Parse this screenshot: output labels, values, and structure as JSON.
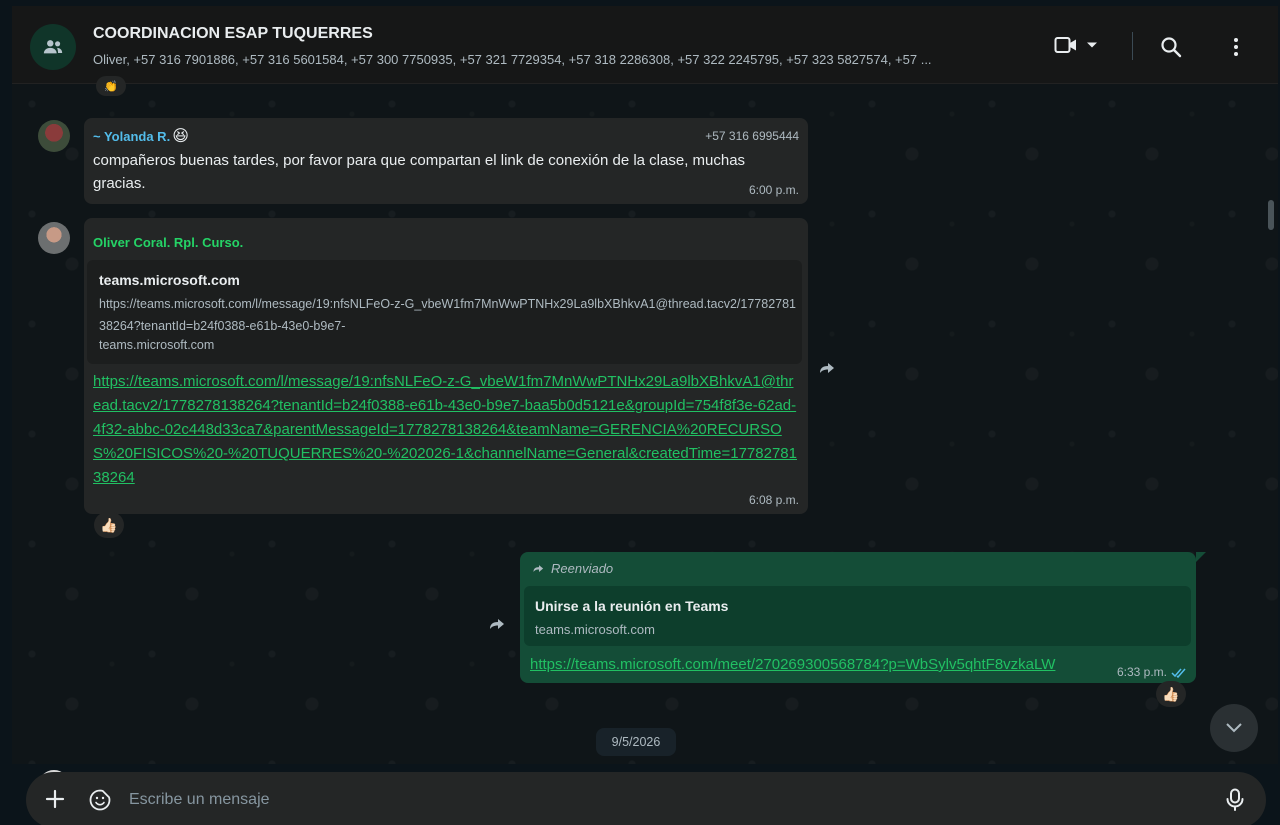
{
  "header": {
    "title": "COORDINACION ESAP TUQUERRES",
    "members": "Oliver, +57 316 7901886, +57 316 5601584, +57 300 7750935, +57 321 7729354, +57 318 2286308, +57 322 2245795, +57 323 5827574, +57 ..."
  },
  "messages": {
    "m1": {
      "sender": "~ Yolanda R.",
      "sender_emoji": "😆",
      "phone": "+57 316 6995444",
      "text": "compañeros buenas tardes, por favor para que compartan el link de conexión de la clase, muchas gracias.",
      "time": "6:00 p.m."
    },
    "m2": {
      "sender": "Oliver Coral. Rpl. Curso.",
      "preview_title": "teams.microsoft.com",
      "preview_desc": "https://teams.microsoft.com/l/message/19:nfsNLFeO-z-G_vbeW1fm7MnWwPTNHx29La9lbXBhkvA1@thread.tacv2/1778278138264?tenantId=b24f0388-e61b-43e0-b9e7-",
      "preview_domain": "teams.microsoft.com",
      "link": "https://teams.microsoft.com/l/message/19:nfsNLFeO-z-G_vbeW1fm7MnWwPTNHx29La9lbXBhkvA1@thread.tacv2/1778278138264?tenantId=b24f0388-e61b-43e0-b9e7-baa5b0d5121e&groupId=754f8f3e-62ad-4f32-abbc-02c448d33ca7&parentMessageId=1778278138264&teamName=GERENCIA%20RECURSOS%20FISICOS%20-%20TUQUERRES%20-%202026-1&channelName=General&createdTime=1778278138264",
      "time": "6:08 p.m.",
      "reaction": "👍🏻"
    },
    "m3": {
      "forwarded_label": "Reenviado",
      "preview_title": "Unirse a la reunión en Teams",
      "preview_domain": "teams.microsoft.com",
      "link": "https://teams.microsoft.com/meet/270269300568784?p=WbSylv5qhtF8vzkaLW",
      "time": "6:33 p.m.",
      "reaction": "👍🏻"
    }
  },
  "date_divider": "9/5/2026",
  "composer": {
    "placeholder": "Escribe un mensaje"
  },
  "colors": {
    "accent_green": "#21c063",
    "outgoing_bubble": "#144d37",
    "incoming_bubble": "#242626",
    "yolanda_name": "#53bdeb",
    "oliver_name": "#25d366"
  }
}
